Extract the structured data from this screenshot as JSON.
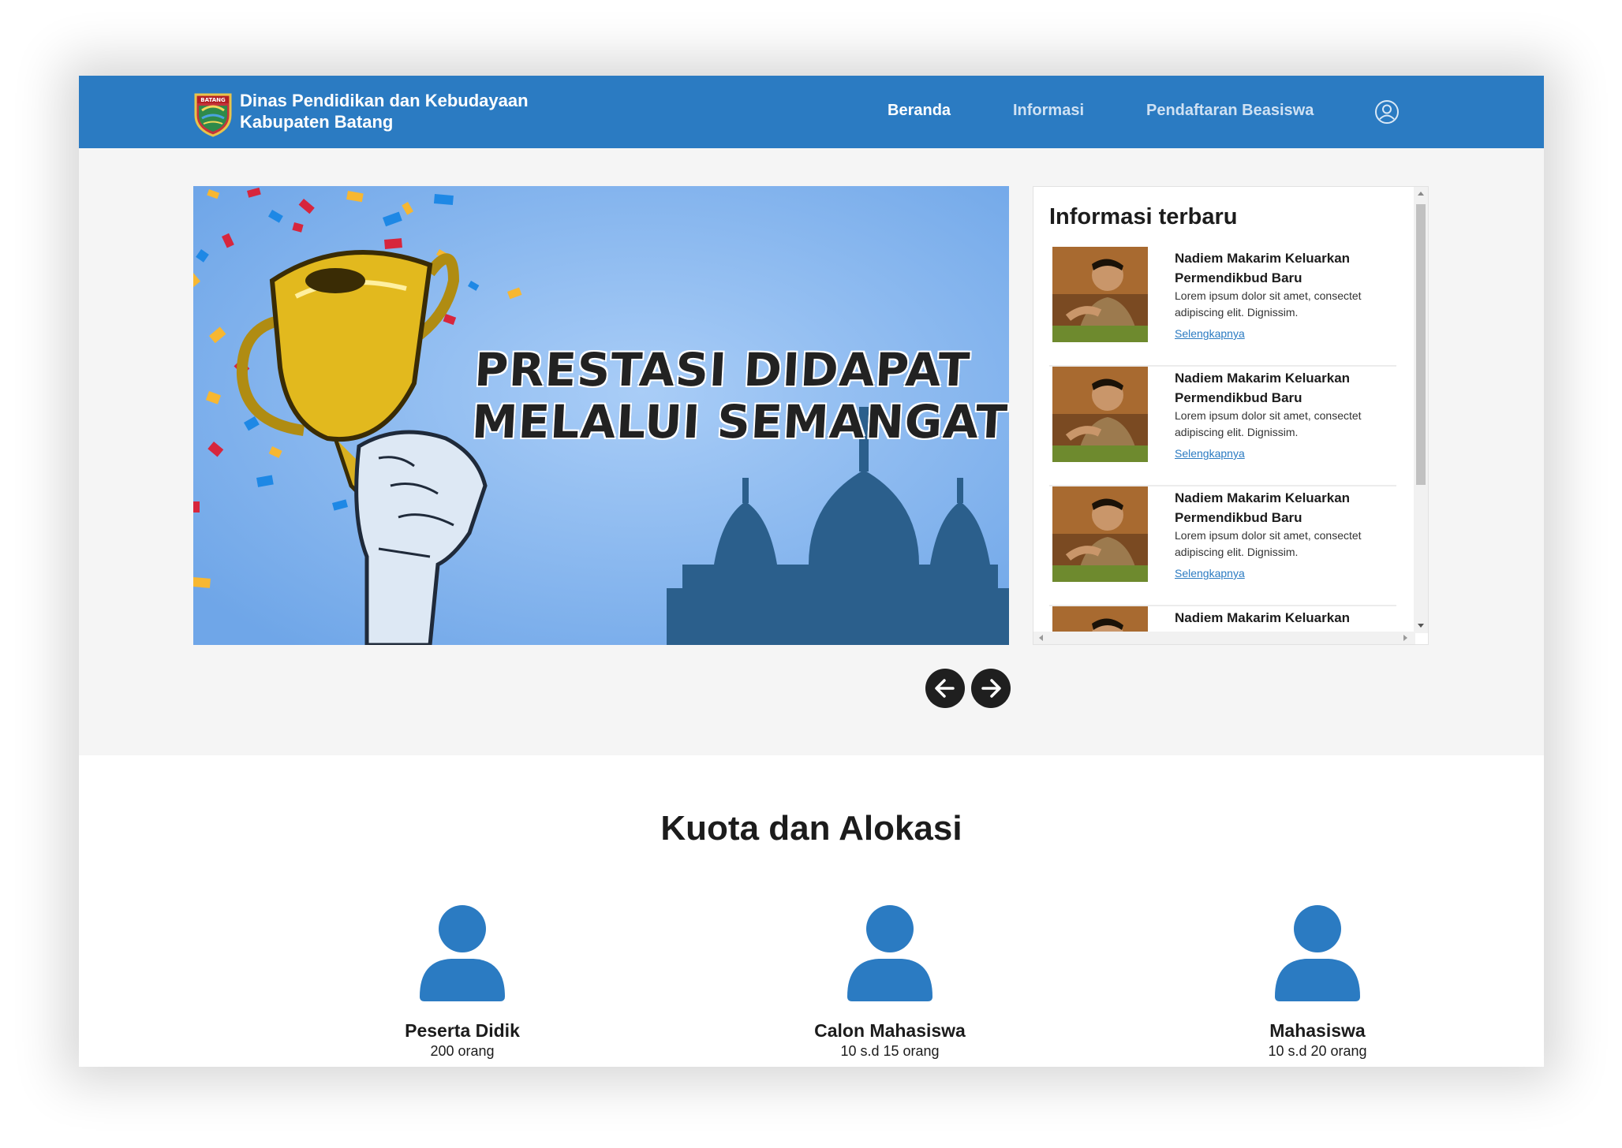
{
  "header": {
    "brand_line1": "Dinas Pendidikan dan Kebudayaan",
    "brand_line2": "Kabupaten Batang",
    "logo_text": "BATANG",
    "nav": [
      {
        "label": "Beranda",
        "active": true
      },
      {
        "label": "Informasi",
        "active": false
      },
      {
        "label": "Pendaftaran Beasiswa",
        "active": false
      }
    ],
    "profile_icon": "user-circle-icon",
    "brand_color": "#2b7bc2"
  },
  "hero": {
    "banner_line1": "PRESTASI DIDAPAT",
    "banner_line2": "MELALUI SEMANGAT",
    "prev_icon": "arrow-left-icon",
    "next_icon": "arrow-right-icon"
  },
  "info": {
    "title": "Informasi terbaru",
    "items": [
      {
        "headline": "Nadiem Makarim Keluarkan Permendikbud Baru",
        "body": "Lorem ipsum dolor sit amet, consectet adipiscing elit. Dignissim.",
        "link": "Selengkapnya"
      },
      {
        "headline": "Nadiem Makarim Keluarkan Permendikbud Baru",
        "body": "Lorem ipsum dolor sit amet, consectet adipiscing elit. Dignissim.",
        "link": "Selengkapnya"
      },
      {
        "headline": "Nadiem Makarim Keluarkan Permendikbud Baru",
        "body": "Lorem ipsum dolor sit amet, consectet adipiscing elit. Dignissim.",
        "link": "Selengkapnya"
      },
      {
        "headline": "Nadiem Makarim Keluarkan",
        "body": "",
        "link": ""
      }
    ]
  },
  "quota": {
    "title": "Kuota dan Alokasi",
    "cards": [
      {
        "label": "Peserta Didik",
        "value": "200 orang",
        "icon": "user-icon"
      },
      {
        "label": "Calon Mahasiswa",
        "value": "10 s.d 15 orang",
        "icon": "user-icon"
      },
      {
        "label": "Mahasiswa",
        "value": "10 s.d 20 orang",
        "icon": "user-icon"
      }
    ]
  }
}
